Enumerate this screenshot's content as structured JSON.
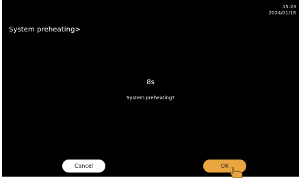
{
  "status": {
    "time": "15:23",
    "date": "2024/01/16"
  },
  "header": {
    "title": "System preheating>"
  },
  "dialog": {
    "countdown": "8s",
    "message": "System preheating?",
    "cancel_label": "Cancel",
    "ok_label": "OK"
  },
  "colors": {
    "background": "#000000",
    "ok_button": "#e9a640",
    "cancel_button": "#ffffff"
  },
  "icons": {
    "pointer": "hand-pointer-icon"
  }
}
